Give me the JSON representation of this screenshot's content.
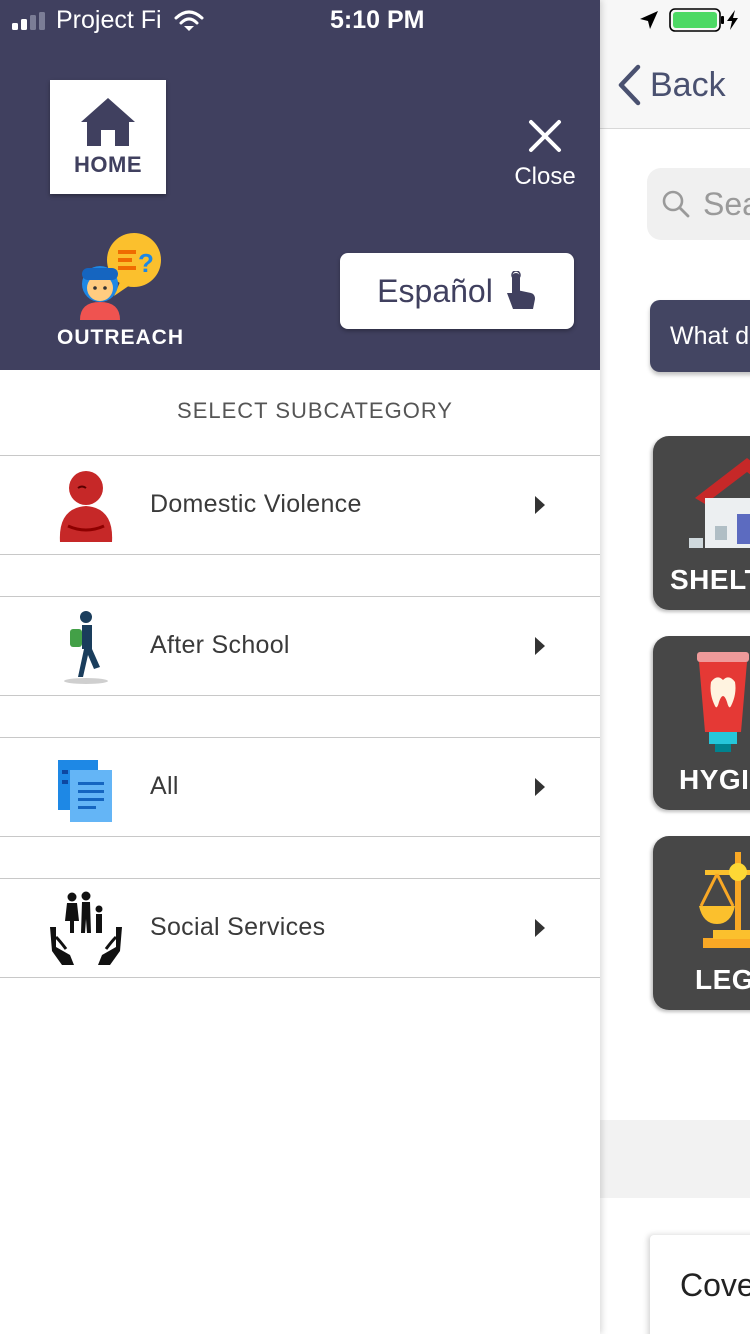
{
  "status_bar": {
    "carrier": "Project Fi",
    "time": "5:10 PM",
    "signal_icon": "signal-bars-icon",
    "wifi_icon": "wifi-icon",
    "location_icon": "location-arrow-icon",
    "battery_icon": "battery-charging-icon",
    "battery_color": "#4cd964"
  },
  "drawer": {
    "header_color": "#40405f",
    "home": {
      "label": "HOME",
      "icon": "home-icon"
    },
    "close": {
      "label": "Close",
      "icon": "close-icon"
    },
    "outreach": {
      "label": "OUTREACH",
      "icon": "outreach-avatar-icon"
    },
    "language_button": {
      "label": "Español",
      "icon": "tap-hand-icon"
    },
    "subcategory_title": "SELECT SUBCATEGORY",
    "subcategories": [
      {
        "label": "Domestic Violence",
        "icon": "domestic-violence-icon"
      },
      {
        "label": "After School",
        "icon": "student-walking-icon"
      },
      {
        "label": "All",
        "icon": "documents-icon"
      },
      {
        "label": "Social Services",
        "icon": "family-hands-icon"
      }
    ]
  },
  "background_page": {
    "back_label": "Back",
    "search_placeholder": "Sea",
    "question_text": "What d",
    "categories": [
      {
        "label": "SHELT",
        "icon": "house-icon"
      },
      {
        "label": "HYGI",
        "icon": "toothpaste-icon"
      },
      {
        "label": "LEG",
        "icon": "scales-of-justice-icon"
      }
    ],
    "bottom_card_text": "Cove",
    "accent_color": "#434562"
  }
}
